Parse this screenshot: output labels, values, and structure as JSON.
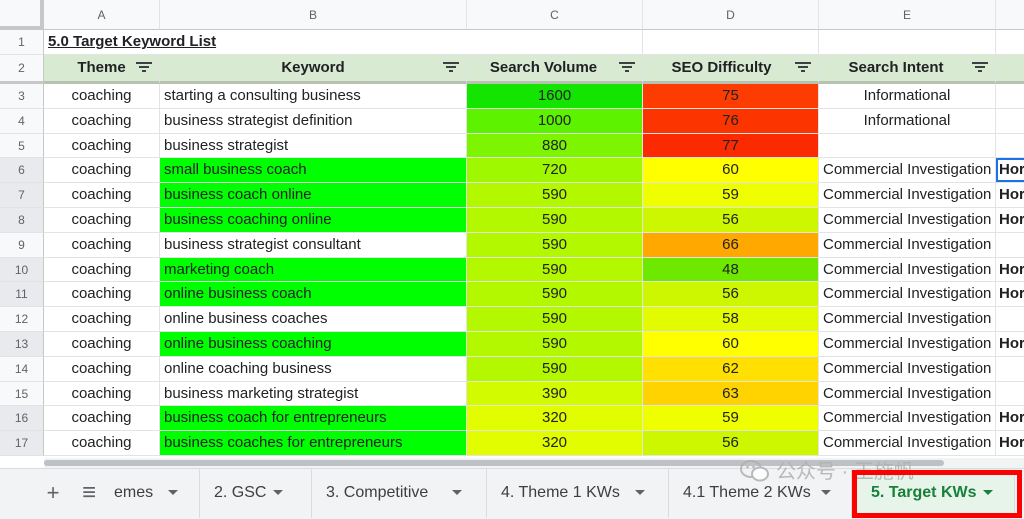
{
  "columns": [
    "A",
    "B",
    "C",
    "D",
    "E"
  ],
  "sheet_title": "5.0 Target Keyword List",
  "headers": {
    "theme": "Theme",
    "keyword": "Keyword",
    "volume": "Search Volume",
    "difficulty": "SEO Difficulty",
    "intent": "Search Intent"
  },
  "header_filter_icon": "filter-icon",
  "row_numbers": [
    "1",
    "2",
    "3",
    "4",
    "5",
    "6",
    "7",
    "8",
    "9",
    "10",
    "11",
    "12",
    "13",
    "14",
    "15",
    "16",
    "17"
  ],
  "colors": {
    "header_fill": "#d9ead3",
    "keyword_highlight": "#00ff00",
    "active_tab": "#188038",
    "callout_frame": "#ff0000"
  },
  "rows": [
    {
      "n": "3",
      "theme": "coaching",
      "keyword": "starting a consulting business",
      "kw_highlight": false,
      "volume": "1600",
      "vol_color": "#14e500",
      "difficulty": "75",
      "diff_color": "#fc3c00",
      "intent": "Informational",
      "intent_center": true,
      "f": ""
    },
    {
      "n": "4",
      "theme": "coaching",
      "keyword": "business strategist definition",
      "kw_highlight": false,
      "volume": "1000",
      "vol_color": "#5cf200",
      "difficulty": "76",
      "diff_color": "#fc3500",
      "intent": "Informational",
      "intent_center": true,
      "f": ""
    },
    {
      "n": "5",
      "theme": "coaching",
      "keyword": "business strategist",
      "kw_highlight": false,
      "volume": "880",
      "vol_color": "#7df400",
      "difficulty": "77",
      "diff_color": "#fb2a00",
      "intent": "",
      "intent_center": true,
      "f": ""
    },
    {
      "n": "6",
      "theme": "coaching",
      "keyword": "small business coach",
      "kw_highlight": true,
      "volume": "720",
      "vol_color": "#9ff700",
      "difficulty": "60",
      "diff_color": "#ffff00",
      "intent": "Commercial Investigation",
      "intent_center": false,
      "f": "Hor"
    },
    {
      "n": "7",
      "theme": "coaching",
      "keyword": "business coach online",
      "kw_highlight": true,
      "volume": "590",
      "vol_color": "#b4f800",
      "difficulty": "59",
      "diff_color": "#f0ff00",
      "intent": "Commercial Investigation",
      "intent_center": false,
      "f": "Hor"
    },
    {
      "n": "8",
      "theme": "coaching",
      "keyword": "business coaching online",
      "kw_highlight": true,
      "volume": "590",
      "vol_color": "#b4f800",
      "difficulty": "56",
      "diff_color": "#ccf700",
      "intent": "Commercial Investigation",
      "intent_center": false,
      "f": "Hor"
    },
    {
      "n": "9",
      "theme": "coaching",
      "keyword": "business strategist consultant",
      "kw_highlight": false,
      "volume": "590",
      "vol_color": "#b4f800",
      "difficulty": "66",
      "diff_color": "#ffa800",
      "intent": "Commercial Investigation",
      "intent_center": false,
      "f": ""
    },
    {
      "n": "10",
      "theme": "coaching",
      "keyword": "marketing coach",
      "kw_highlight": true,
      "volume": "590",
      "vol_color": "#b4f800",
      "difficulty": "48",
      "diff_color": "#6fe800",
      "intent": "Commercial Investigation",
      "intent_center": false,
      "f": "Hor"
    },
    {
      "n": "11",
      "theme": "coaching",
      "keyword": "online business coach",
      "kw_highlight": true,
      "volume": "590",
      "vol_color": "#b4f800",
      "difficulty": "56",
      "diff_color": "#ccf700",
      "intent": "Commercial Investigation",
      "intent_center": false,
      "f": "Hor"
    },
    {
      "n": "12",
      "theme": "coaching",
      "keyword": "online business coaches",
      "kw_highlight": false,
      "volume": "590",
      "vol_color": "#b4f800",
      "difficulty": "58",
      "diff_color": "#e2fb00",
      "intent": "Commercial Investigation",
      "intent_center": false,
      "f": ""
    },
    {
      "n": "13",
      "theme": "coaching",
      "keyword": "online business coaching",
      "kw_highlight": true,
      "volume": "590",
      "vol_color": "#b4f800",
      "difficulty": "60",
      "diff_color": "#ffff00",
      "intent": "Commercial Investigation",
      "intent_center": false,
      "f": "Hor"
    },
    {
      "n": "14",
      "theme": "coaching",
      "keyword": "online coaching business",
      "kw_highlight": false,
      "volume": "590",
      "vol_color": "#b4f800",
      "difficulty": "62",
      "diff_color": "#ffe000",
      "intent": "Commercial Investigation",
      "intent_center": false,
      "f": ""
    },
    {
      "n": "15",
      "theme": "coaching",
      "keyword": "business marketing strategist",
      "kw_highlight": false,
      "volume": "390",
      "vol_color": "#d2fb00",
      "difficulty": "63",
      "diff_color": "#ffd300",
      "intent": "Commercial Investigation",
      "intent_center": false,
      "f": ""
    },
    {
      "n": "16",
      "theme": "coaching",
      "keyword": "business coach for entrepreneurs",
      "kw_highlight": true,
      "volume": "320",
      "vol_color": "#e2fd00",
      "difficulty": "59",
      "diff_color": "#f0ff00",
      "intent": "Commercial Investigation",
      "intent_center": false,
      "f": "Hor"
    },
    {
      "n": "17",
      "theme": "coaching",
      "keyword": "business coaches for entrepreneurs",
      "kw_highlight": true,
      "volume": "320",
      "vol_color": "#e2fd00",
      "difficulty": "56",
      "diff_color": "#ccf700",
      "intent": "Commercial Investigation",
      "intent_center": false,
      "f": "Hor"
    }
  ],
  "toolbar": {
    "add_sheet_icon": "plus-icon",
    "all_sheets_icon": "menu-lines-icon",
    "add_sheet_symbol": "+",
    "all_sheets_symbol": "≡"
  },
  "tabs": [
    {
      "label": "emes",
      "active": false
    },
    {
      "label": "2. GSC",
      "active": false
    },
    {
      "label": "3. Competitive",
      "active": false
    },
    {
      "label": "4. Theme 1 KWs",
      "active": false
    },
    {
      "label": "4.1 Theme 2 KWs",
      "active": false
    },
    {
      "label": "5. Target KWs",
      "active": true
    }
  ],
  "watermark": "公众号 · 王施帆"
}
